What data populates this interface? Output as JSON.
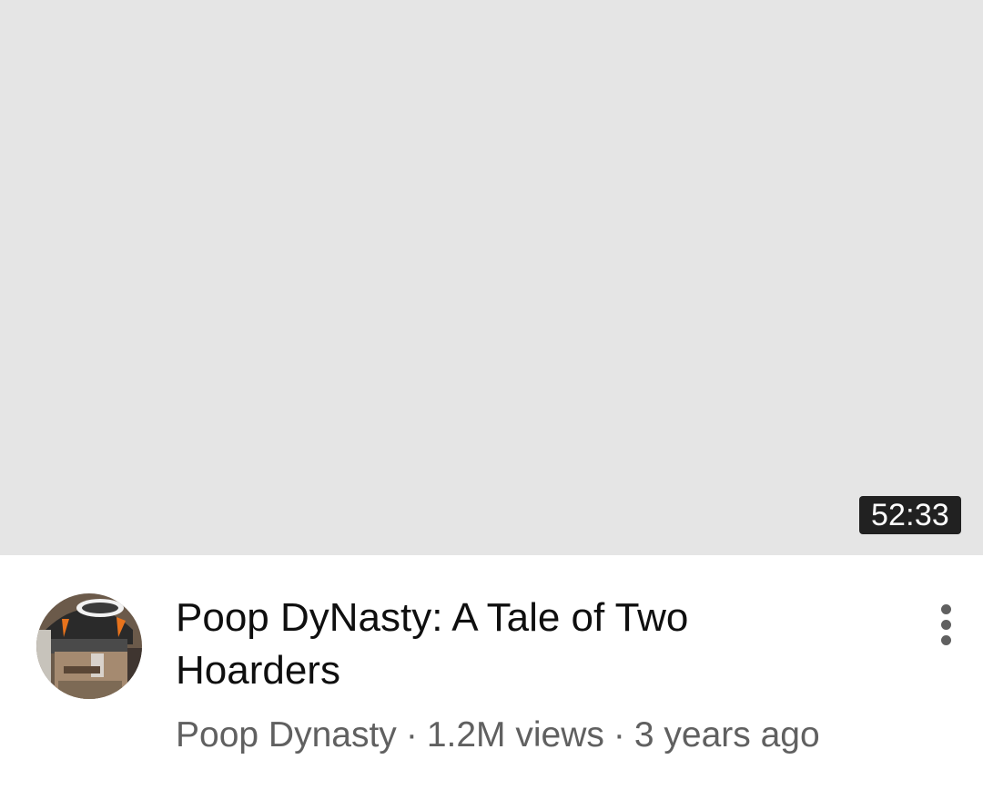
{
  "video": {
    "duration": "52:33",
    "title": "Poop DyNasty: A Tale of Two Hoarders",
    "channel": "Poop Dynasty",
    "views": "1.2M views",
    "age": "3 years ago",
    "separator": "·"
  },
  "icons": {
    "avatar": "channel-avatar",
    "more": "more-vert-icon"
  },
  "colors": {
    "thumbnail_placeholder": "#e5e5e5",
    "duration_badge_bg": "#212121",
    "title_text": "#0f0f0f",
    "meta_text": "#606060"
  }
}
